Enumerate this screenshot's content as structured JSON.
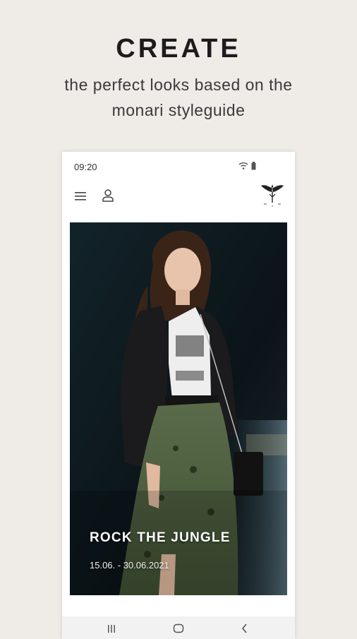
{
  "header": {
    "title": "CREATE",
    "subtitle": "the perfect looks based on the monari styleguide"
  },
  "status_bar": {
    "time": "09:20",
    "icons": [
      "wifi-icon",
      "battery-icon"
    ]
  },
  "app_bar": {
    "menu_icon": "menu-icon",
    "account_icon": "account-icon",
    "logo": "monari-logo"
  },
  "campaign": {
    "title": "ROCK THE JUNGLE",
    "dates": "15.06. - 30.06.2021"
  },
  "nav_bar": {
    "buttons": [
      "recent-apps-icon",
      "home-icon",
      "back-icon"
    ]
  },
  "colors": {
    "background": "#efebe7",
    "phone_background": "#ffffff",
    "text": "#1c1c1c"
  }
}
